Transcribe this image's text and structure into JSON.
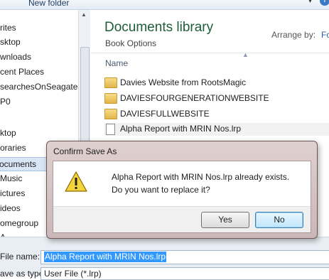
{
  "toolbar": {
    "new_folder": "New folder"
  },
  "nav": {
    "items": [
      "rites",
      "sktop",
      "wnloads",
      "cent Places",
      "searchesOnSeagate",
      "P0",
      "ktop",
      "oraries",
      "ocuments",
      "Music",
      "ictures",
      "ideos",
      "omegroup",
      "A"
    ],
    "selected": "ocuments"
  },
  "library": {
    "title": "Documents library",
    "subtitle": "Book Options",
    "arrange_label": "Arrange by:",
    "arrange_value": "Fo"
  },
  "columns": {
    "name": "Name"
  },
  "files": [
    {
      "name": "Davies Website from RootsMagic",
      "type": "folder"
    },
    {
      "name": "DAVIESFOURGENERATIONWEBSITE",
      "type": "folder"
    },
    {
      "name": "DAVIESFULLWEBSITE",
      "type": "folder"
    },
    {
      "name": "Alpha Report with MRIN Nos.lrp",
      "type": "document"
    }
  ],
  "dialog": {
    "title": "Confirm Save As",
    "message_line1": "Alpha Report with MRIN Nos.lrp already exists.",
    "message_line2": "Do you want to replace it?",
    "yes": "Yes",
    "no": "No"
  },
  "bottom": {
    "file_name_label": "File name:",
    "file_name_value": "Alpha Report with MRIN Nos.lrp",
    "save_type_label": "ave as type:",
    "save_type_value": "User File (*.lrp)"
  },
  "colors": {
    "library_title": "#1e5d3a",
    "selection": "#3399ff",
    "dialog_frame": "#cbb7b7"
  }
}
